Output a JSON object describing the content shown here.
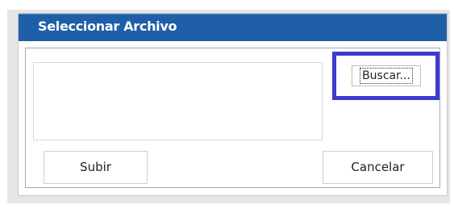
{
  "dialog": {
    "title": "Seleccionar Archivo",
    "file_display_value": "",
    "browse_label": "Buscar...",
    "upload_label": "Subir",
    "cancel_label": "Cancelar"
  },
  "colors": {
    "title_bar": "#1f5fa8",
    "highlight_border": "#3b3bd1",
    "title_text": "#ffffff"
  }
}
